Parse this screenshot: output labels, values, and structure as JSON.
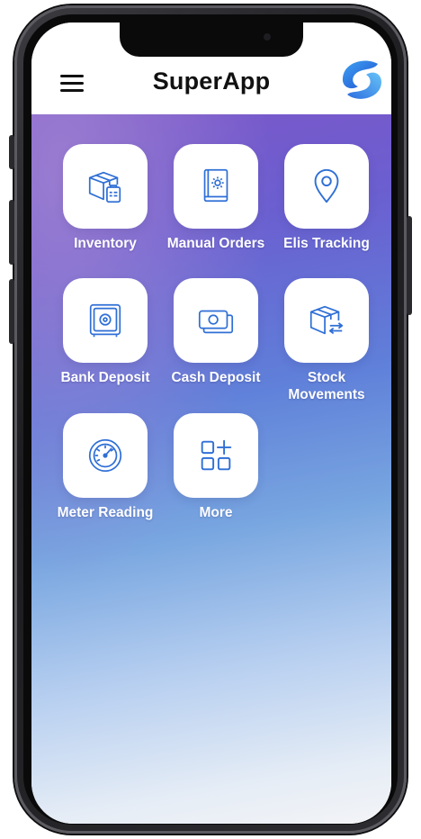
{
  "app": {
    "title": "SuperApp"
  },
  "icons": {
    "menu": "hamburger-menu-icon",
    "logo": "superapp-logo"
  },
  "colors": {
    "icon_blue": "#2f6fd6",
    "header_bg": "#ffffff",
    "gradient_top": "#7b57c9",
    "gradient_mid": "#78a6e0",
    "gradient_bottom": "#f3f4f7",
    "logo_dark": "#1f4fd0",
    "logo_light": "#3fa2f2"
  },
  "tiles": [
    {
      "label": "Inventory",
      "icon": "box-clipboard-icon"
    },
    {
      "label": "Manual Orders",
      "icon": "book-gear-icon"
    },
    {
      "label": "Elis Tracking",
      "icon": "location-pin-icon"
    },
    {
      "label": "Bank Deposit",
      "icon": "safe-icon"
    },
    {
      "label": "Cash Deposit",
      "icon": "cash-icon"
    },
    {
      "label": "Stock\nMovements",
      "icon": "box-arrows-icon"
    },
    {
      "label": "Meter Reading",
      "icon": "gauge-icon"
    },
    {
      "label": "More",
      "icon": "grid-plus-icon"
    }
  ]
}
